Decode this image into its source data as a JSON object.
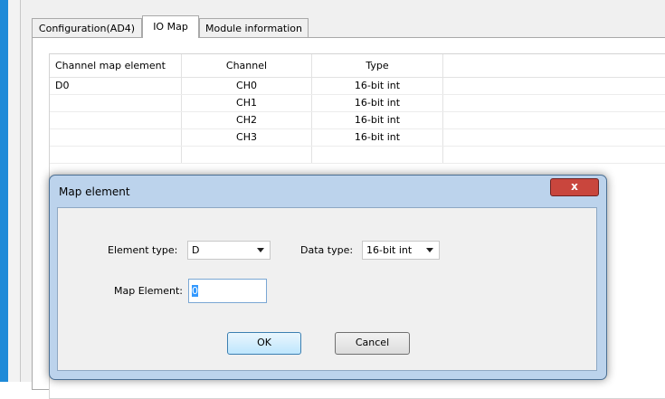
{
  "tabs": [
    {
      "label": "Configuration(AD4)",
      "active": false
    },
    {
      "label": "IO Map",
      "active": true
    },
    {
      "label": "Module information",
      "active": false
    }
  ],
  "table": {
    "headers": [
      "Channel map element",
      "Channel",
      "Type"
    ],
    "rows": [
      [
        "D0",
        "CH0",
        "16-bit int"
      ],
      [
        "",
        "CH1",
        "16-bit int"
      ],
      [
        "",
        "CH2",
        "16-bit int"
      ],
      [
        "",
        "CH3",
        "16-bit int"
      ]
    ]
  },
  "dialog": {
    "title": "Map element",
    "close_glyph": "x",
    "element_type_label": "Element type:",
    "element_type_value": "D",
    "data_type_label": "Data type:",
    "data_type_value": "16-bit int",
    "map_element_label": "Map Element:",
    "map_element_value": "0",
    "ok_label": "OK",
    "cancel_label": "Cancel"
  },
  "colors": {
    "accent_bar": "#1f8ad8",
    "dialog_frame": "#bcd3ec",
    "close_button": "#c9463d",
    "selection": "#3399ff"
  }
}
